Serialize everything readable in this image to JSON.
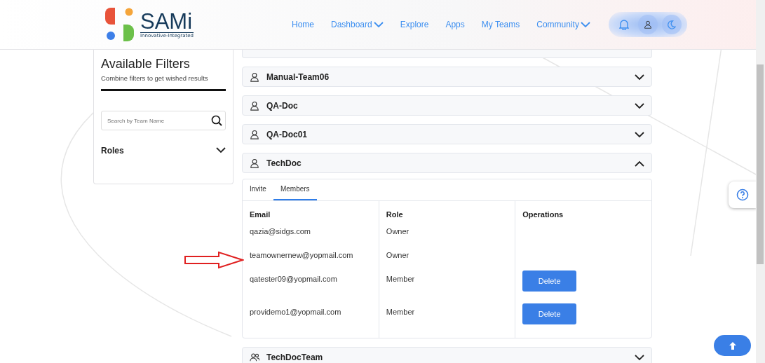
{
  "header": {
    "logo_text": "SAMi",
    "logo_tagline": "Innovative-Integrated",
    "nav": [
      {
        "label": "Home",
        "dropdown": false
      },
      {
        "label": "Dashboard",
        "dropdown": true
      },
      {
        "label": "Explore",
        "dropdown": false
      },
      {
        "label": "Apps",
        "dropdown": false
      },
      {
        "label": "My Teams",
        "dropdown": false
      },
      {
        "label": "Community",
        "dropdown": true
      }
    ]
  },
  "filters": {
    "title": "Available Filters",
    "subtitle": "Combine filters to get wished results",
    "search": {
      "placeholder": "Search by Team Name"
    },
    "sections": [
      {
        "label": "Roles",
        "expanded": false
      }
    ]
  },
  "teams": [
    {
      "name": "Manual-Team06",
      "kind": "person",
      "expanded": false
    },
    {
      "name": "QA-Doc",
      "kind": "person",
      "expanded": false
    },
    {
      "name": "QA-Doc01",
      "kind": "person",
      "expanded": false
    },
    {
      "name": "TechDoc",
      "kind": "person",
      "expanded": true,
      "tabs": [
        {
          "label": "Invite",
          "selected": false
        },
        {
          "label": "Members",
          "selected": true
        }
      ],
      "columns": [
        "Email",
        "Role",
        "Operations"
      ],
      "members": [
        {
          "email": "qazia@sidgs.com",
          "role": "Owner"
        },
        {
          "email": "teamownernew@yopmail.com",
          "role": "Owner"
        },
        {
          "email": "qatester09@yopmail.com",
          "role": "Member",
          "operation": "Delete"
        },
        {
          "email": "providemo1@yopmail.com",
          "role": "Member",
          "operation": "Delete"
        }
      ]
    },
    {
      "name": "TechDocTeam",
      "kind": "group",
      "expanded": false
    }
  ]
}
